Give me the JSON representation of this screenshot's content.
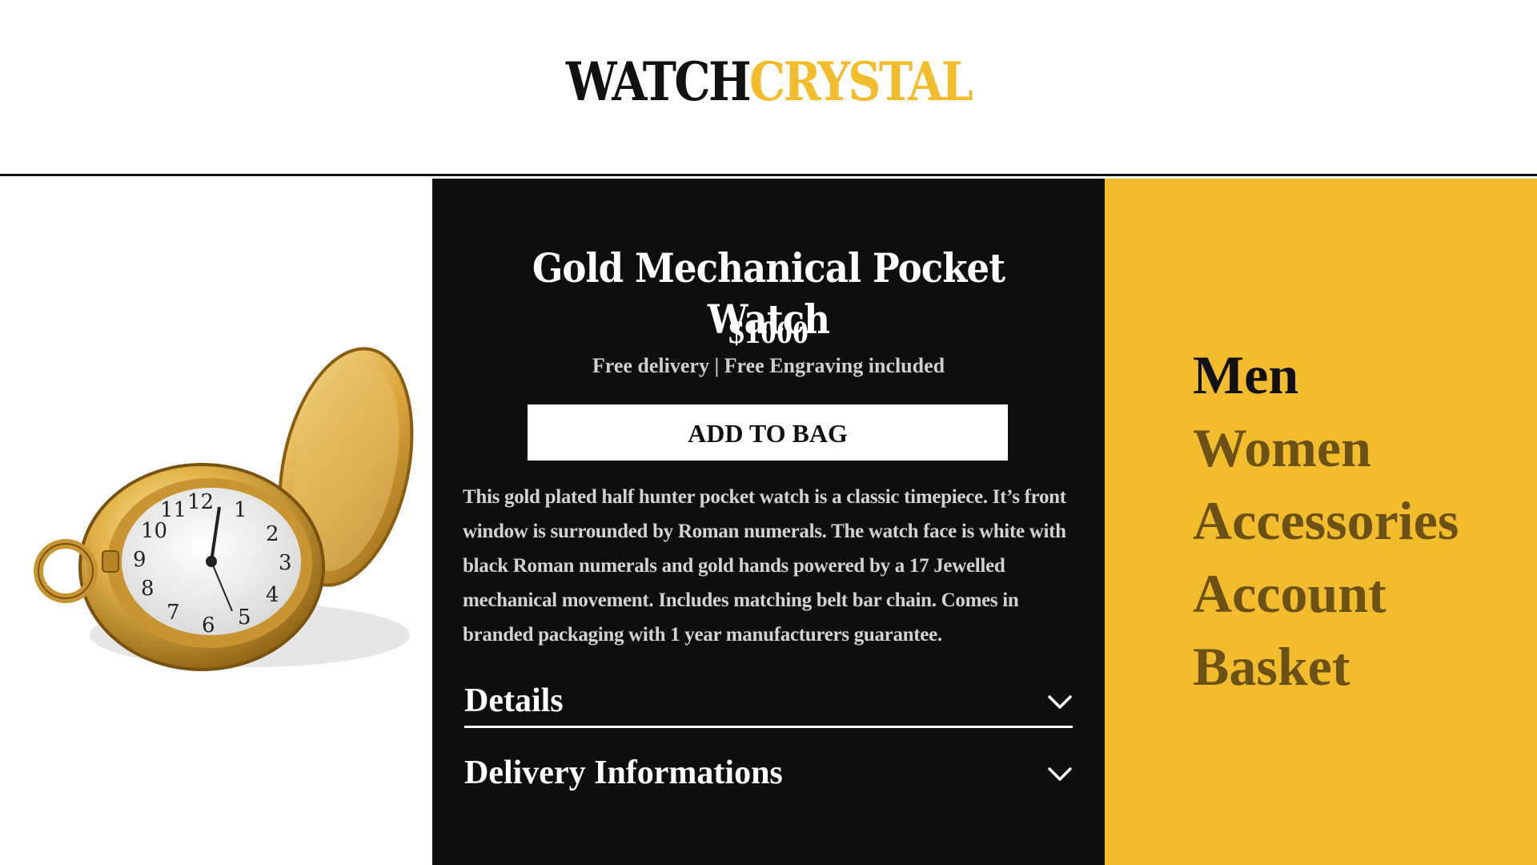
{
  "header": {
    "logo_dark": "WATCH",
    "logo_gold": "CRYSTAL"
  },
  "product": {
    "title": "Gold Mechanical Pocket Watch",
    "price": "$1000",
    "perks": "Free delivery | Free Engraving included",
    "add_to_bag_label": "ADD TO BAG",
    "description": "This gold plated half hunter pocket watch is a classic timepiece. It’s front window is surrounded by Roman numerals. The watch face is white with black Roman numerals and gold hands powered by a 17 Jewelled mechanical movement. Includes matching belt bar chain. Comes in branded packaging with 1 year manufacturers guarantee.",
    "accordions": [
      {
        "label": "Details",
        "icon": "chevron-down-icon"
      },
      {
        "label": "Delivery Informations",
        "icon": "chevron-down-icon"
      }
    ]
  },
  "nav": {
    "items": [
      {
        "label": "Men",
        "active": true
      },
      {
        "label": "Women",
        "active": false
      },
      {
        "label": "Accessories",
        "active": false
      },
      {
        "label": "Account",
        "active": false
      },
      {
        "label": "Basket",
        "active": false
      }
    ]
  },
  "colors": {
    "accent_gold": "#f2bc2d",
    "dark_panel": "#0e0e0e",
    "nav_text": "#6b5214",
    "nav_active_text": "#111111"
  }
}
